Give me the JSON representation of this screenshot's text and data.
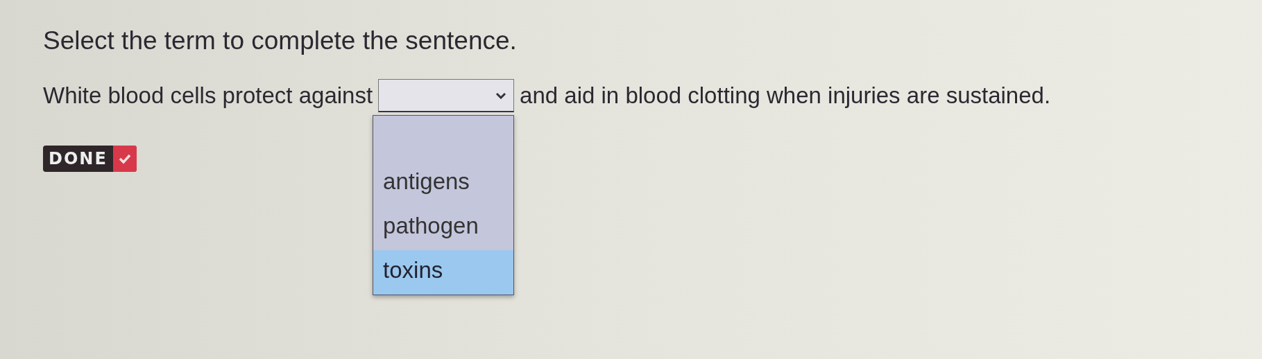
{
  "instruction": "Select the term to complete the sentence.",
  "sentence": {
    "before": "White blood cells protect against",
    "after": "and aid in blood clotting when injuries are sustained."
  },
  "dropdown": {
    "expanded": true,
    "options": [
      {
        "label": "antigens",
        "selected": false
      },
      {
        "label": "pathogen",
        "selected": false
      },
      {
        "label": "toxins",
        "selected": true
      }
    ]
  },
  "done_button": {
    "label": "DONE",
    "checked": true
  }
}
